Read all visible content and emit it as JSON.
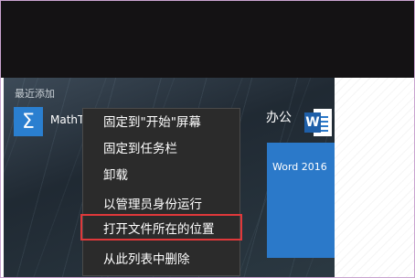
{
  "recent": {
    "label": "最近添加",
    "app_name": "MathType",
    "app_icon_glyph": "Σ"
  },
  "tiles": {
    "group_title": "办公",
    "word_label": "Word 2016",
    "word_badge": "W",
    "word_color": "#2b79c9"
  },
  "context_menu": {
    "items": [
      "固定到\"开始\"屏幕",
      "固定到任务栏",
      "卸载",
      "以管理员身份运行",
      "打开文件所在的位置",
      "从此列表中删除"
    ],
    "highlight_color": "#e0383a"
  }
}
